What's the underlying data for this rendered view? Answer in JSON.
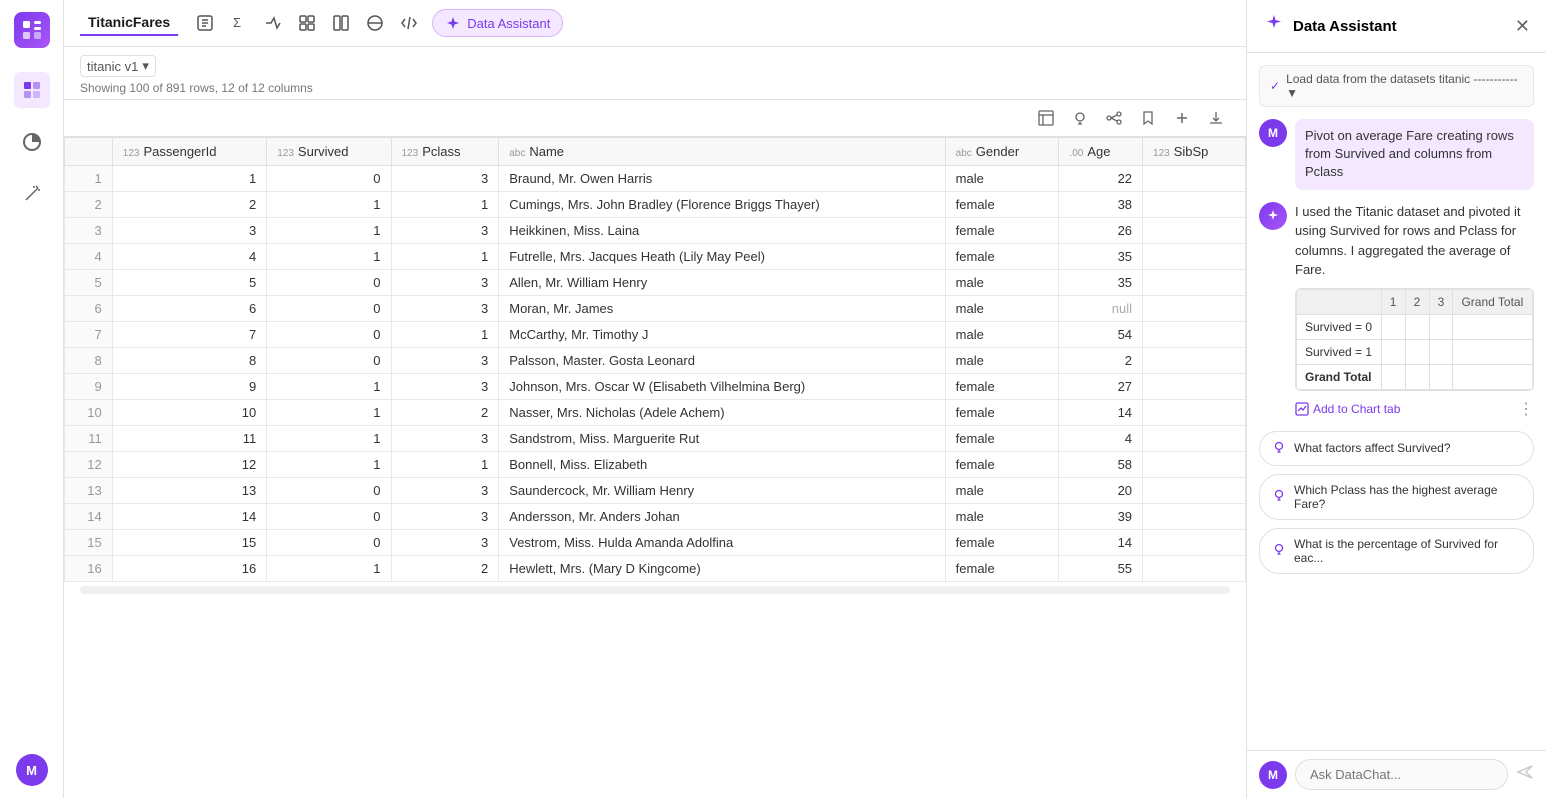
{
  "app": {
    "logo": "≋",
    "tab_label": "TitanicFares"
  },
  "toolbar": {
    "icons": [
      {
        "name": "edit-icon",
        "symbol": "✎"
      },
      {
        "name": "sigma-icon",
        "symbol": "Σ"
      },
      {
        "name": "arrow-icon",
        "symbol": "≫"
      },
      {
        "name": "grid-icon",
        "symbol": "⊞"
      },
      {
        "name": "split-icon",
        "symbol": "◫"
      },
      {
        "name": "circle-icon",
        "symbol": "◑"
      },
      {
        "name": "code-icon",
        "symbol": "<>"
      }
    ],
    "data_assistant_btn": "Data Assistant"
  },
  "dataset": {
    "name": "titanic v1",
    "row_info": "Showing 100 of 891 rows, 12 of 12 columns"
  },
  "table": {
    "columns": [
      {
        "type": "123",
        "label": "PassengerId"
      },
      {
        "type": "123",
        "label": "Survived"
      },
      {
        "type": "123",
        "label": "Pclass"
      },
      {
        "type": "abc",
        "label": "Name"
      },
      {
        "type": "abc",
        "label": "Gender"
      },
      {
        "type": ".00",
        "label": "Age"
      },
      {
        "type": "123",
        "label": "SibSp"
      }
    ],
    "rows": [
      {
        "idx": 1,
        "PassengerId": 1,
        "Survived": 0,
        "Pclass": 3,
        "Name": "Braund, Mr. Owen Harris",
        "Gender": "male",
        "Age": "22",
        "SibSp": ""
      },
      {
        "idx": 2,
        "PassengerId": 2,
        "Survived": 1,
        "Pclass": 1,
        "Name": "Cumings, Mrs. John Bradley (Florence Briggs Thayer)",
        "Gender": "female",
        "Age": "38",
        "SibSp": ""
      },
      {
        "idx": 3,
        "PassengerId": 3,
        "Survived": 1,
        "Pclass": 3,
        "Name": "Heikkinen, Miss. Laina",
        "Gender": "female",
        "Age": "26",
        "SibSp": ""
      },
      {
        "idx": 4,
        "PassengerId": 4,
        "Survived": 1,
        "Pclass": 1,
        "Name": "Futrelle, Mrs. Jacques Heath (Lily May Peel)",
        "Gender": "female",
        "Age": "35",
        "SibSp": ""
      },
      {
        "idx": 5,
        "PassengerId": 5,
        "Survived": 0,
        "Pclass": 3,
        "Name": "Allen, Mr. William Henry",
        "Gender": "male",
        "Age": "35",
        "SibSp": ""
      },
      {
        "idx": 6,
        "PassengerId": 6,
        "Survived": 0,
        "Pclass": 3,
        "Name": "Moran, Mr. James",
        "Gender": "male",
        "Age": "null",
        "SibSp": ""
      },
      {
        "idx": 7,
        "PassengerId": 7,
        "Survived": 0,
        "Pclass": 1,
        "Name": "McCarthy, Mr. Timothy J",
        "Gender": "male",
        "Age": "54",
        "SibSp": ""
      },
      {
        "idx": 8,
        "PassengerId": 8,
        "Survived": 0,
        "Pclass": 3,
        "Name": "Palsson, Master. Gosta Leonard",
        "Gender": "male",
        "Age": "2",
        "SibSp": ""
      },
      {
        "idx": 9,
        "PassengerId": 9,
        "Survived": 1,
        "Pclass": 3,
        "Name": "Johnson, Mrs. Oscar W (Elisabeth Vilhelmina Berg)",
        "Gender": "female",
        "Age": "27",
        "SibSp": ""
      },
      {
        "idx": 10,
        "PassengerId": 10,
        "Survived": 1,
        "Pclass": 2,
        "Name": "Nasser, Mrs. Nicholas (Adele Achem)",
        "Gender": "female",
        "Age": "14",
        "SibSp": ""
      },
      {
        "idx": 11,
        "PassengerId": 11,
        "Survived": 1,
        "Pclass": 3,
        "Name": "Sandstrom, Miss. Marguerite Rut",
        "Gender": "female",
        "Age": "4",
        "SibSp": ""
      },
      {
        "idx": 12,
        "PassengerId": 12,
        "Survived": 1,
        "Pclass": 1,
        "Name": "Bonnell, Miss. Elizabeth",
        "Gender": "female",
        "Age": "58",
        "SibSp": ""
      },
      {
        "idx": 13,
        "PassengerId": 13,
        "Survived": 0,
        "Pclass": 3,
        "Name": "Saundercock, Mr. William Henry",
        "Gender": "male",
        "Age": "20",
        "SibSp": ""
      },
      {
        "idx": 14,
        "PassengerId": 14,
        "Survived": 0,
        "Pclass": 3,
        "Name": "Andersson, Mr. Anders Johan",
        "Gender": "male",
        "Age": "39",
        "SibSp": ""
      },
      {
        "idx": 15,
        "PassengerId": 15,
        "Survived": 0,
        "Pclass": 3,
        "Name": "Vestrom, Miss. Hulda Amanda Adolfina",
        "Gender": "female",
        "Age": "14",
        "SibSp": ""
      },
      {
        "idx": 16,
        "PassengerId": 16,
        "Survived": 1,
        "Pclass": 2,
        "Name": "Hewlett, Mrs. (Mary D Kingcome)",
        "Gender": "female",
        "Age": "55",
        "SibSp": ""
      }
    ]
  },
  "table_icons": [
    {
      "name": "chart-icon",
      "symbol": "▤"
    },
    {
      "name": "bulb-icon",
      "symbol": "💡"
    },
    {
      "name": "branch-icon",
      "symbol": "⑂"
    },
    {
      "name": "bookmark-icon",
      "symbol": "🔖"
    },
    {
      "name": "plus-icon",
      "symbol": "+"
    },
    {
      "name": "download-icon",
      "symbol": "⬇"
    }
  ],
  "sidebar_icons": [
    {
      "name": "table-icon",
      "symbol": "⊞",
      "active": true
    },
    {
      "name": "pie-chart-icon",
      "symbol": "◑",
      "active": false
    },
    {
      "name": "wand-icon",
      "symbol": "✦",
      "active": false
    }
  ],
  "right_panel": {
    "title": "Data Assistant",
    "load_data_msg": "Load data from the datasets titanic ----------- ▼",
    "user_message": "Pivot on average Fare creating rows from Survived and columns from Pclass",
    "ai_response": "I used the Titanic dataset and pivoted it using Survived for rows and Pclass for columns. I aggregated the average of Fare.",
    "pivot_table": {
      "header_row": [
        "",
        "1",
        "2",
        "3",
        "Grand Total"
      ],
      "rows": [
        {
          "label": "Survived = 0",
          "v1": "",
          "v2": "",
          "v3": "",
          "vTotal": ""
        },
        {
          "label": "Survived = 1",
          "v1": "",
          "v2": "",
          "v3": "",
          "vTotal": ""
        },
        {
          "label": "Grand Total",
          "v1": "",
          "v2": "",
          "v3": "",
          "vTotal": ""
        }
      ]
    },
    "add_chart_label": "Add to Chart tab",
    "suggestions": [
      "What factors affect Survived?",
      "Which Pclass has the highest average Fare?",
      "What is the percentage of Survived for eac..."
    ],
    "chat_placeholder": "Ask DataChat...",
    "user_initial": "M"
  }
}
